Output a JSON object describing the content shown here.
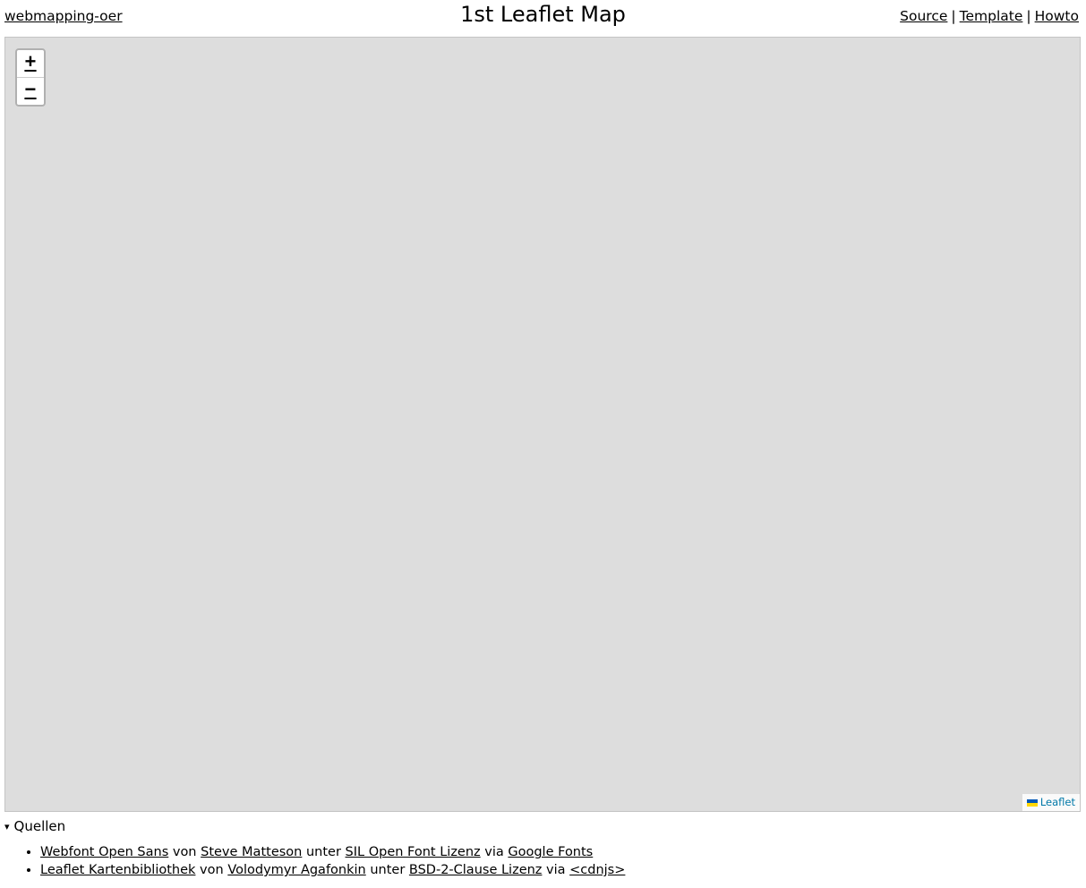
{
  "header": {
    "home_link": "webmapping-oer",
    "title": "1st Leaflet Map",
    "nav": {
      "source": "Source",
      "template": "Template",
      "howto": "Howto",
      "separator": "|"
    }
  },
  "map": {
    "background_color": "#dddddd",
    "zoom_in": "+",
    "zoom_out": "−",
    "attribution": "Leaflet"
  },
  "sources": {
    "caret": "▾",
    "summary": "Quellen",
    "items": [
      {
        "link1": "Webfont Open Sans",
        "t1": "von",
        "link2": "Steve Matteson",
        "t2": "unter",
        "link3": "SIL Open Font Lizenz",
        "t3": "via",
        "link4": "Google Fonts"
      },
      {
        "link1": "Leaflet Kartenbibliothek",
        "t1": "von",
        "link2": "Volodymyr Agafonkin",
        "t2": "unter",
        "link3": "BSD-2-Clause Lizenz",
        "t3": "via",
        "link4": "<cdnjs>"
      }
    ]
  }
}
